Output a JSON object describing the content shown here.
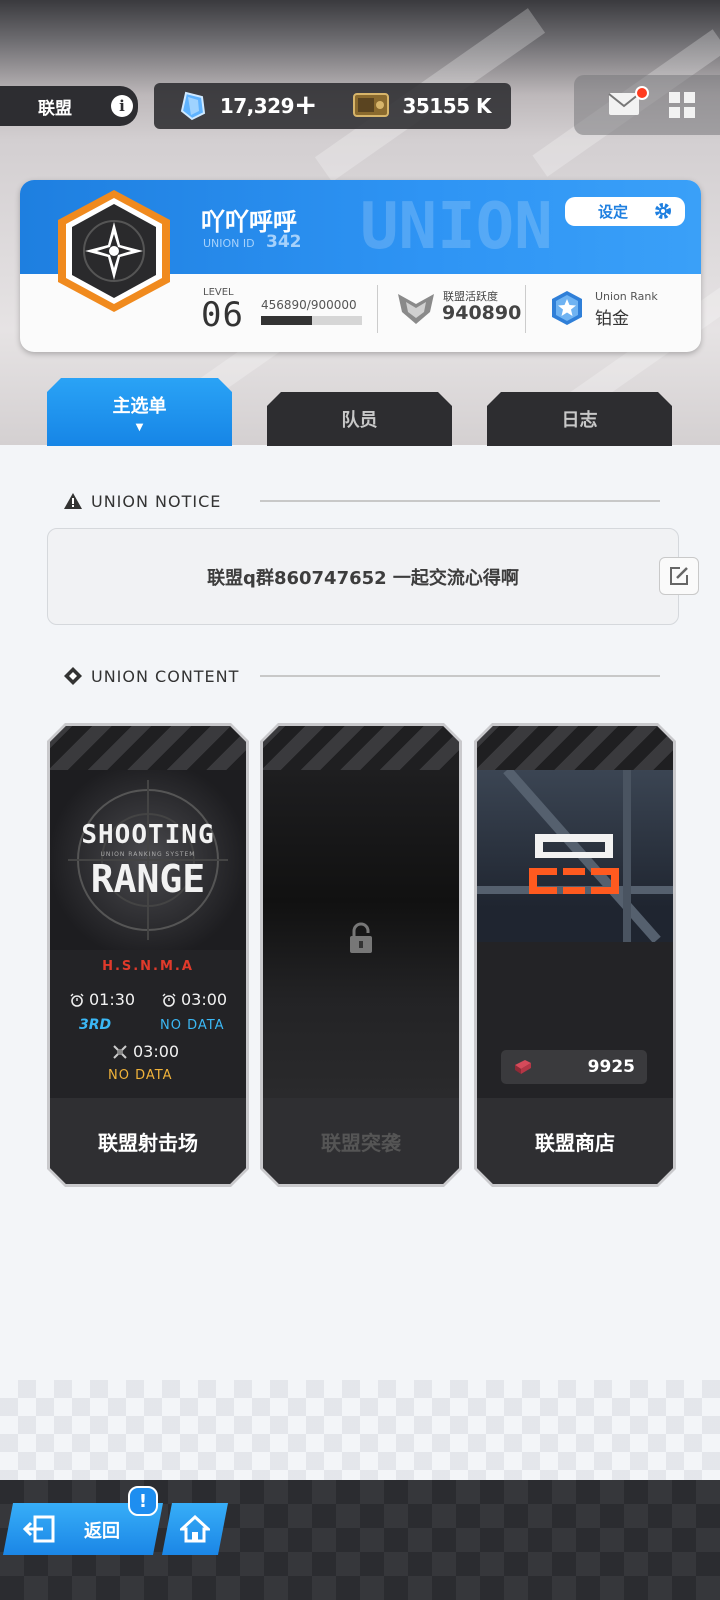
{
  "header": {
    "union_label": "联盟",
    "info_icon": "info-icon",
    "gems": "17,329",
    "gems_plus": "+",
    "credits": "35155 K",
    "mail_icon": "mail-icon",
    "grid_icon": "grid-menu-icon"
  },
  "union": {
    "name": "吖吖呼呼",
    "id_label": "UNION ID",
    "id_value": "342",
    "settings_label": "设定",
    "level_label": "LEVEL",
    "level_value": "06",
    "exp_text": "456890/900000",
    "exp_progress": 0.5077,
    "activity_label": "联盟活跃度",
    "activity_value": "940890",
    "rank_label": "Union Rank",
    "rank_value": "铂金"
  },
  "tabs": [
    {
      "label": "主选单",
      "active": true
    },
    {
      "label": "队员",
      "active": false
    },
    {
      "label": "日志",
      "active": false
    }
  ],
  "notice": {
    "heading": "UNION NOTICE",
    "text": "联盟q群860747652 一起交流心得啊"
  },
  "content": {
    "heading": "UNION CONTENT",
    "cards": [
      {
        "title": "联盟射击场",
        "art_title_1": "SHOOTING",
        "art_subtitle": "UNION RANKING SYSTEM",
        "art_title_2": "RANGE",
        "brand": "H.S.N.M.A",
        "time1": "01:30",
        "time2": "03:00",
        "rank": "3RD",
        "nodata1": "NO DATA",
        "time3": "03:00",
        "nodata2": "NO DATA"
      },
      {
        "title": "联盟突袭",
        "locked": true
      },
      {
        "title": "联盟商店",
        "currency_value": "9925"
      }
    ]
  },
  "footer": {
    "back_label": "返回",
    "alert_badge": "!"
  },
  "colors": {
    "accent_blue": "#1e7fe0",
    "dark_panel": "#2b2b2e",
    "notification_red": "#ff3b1f"
  }
}
